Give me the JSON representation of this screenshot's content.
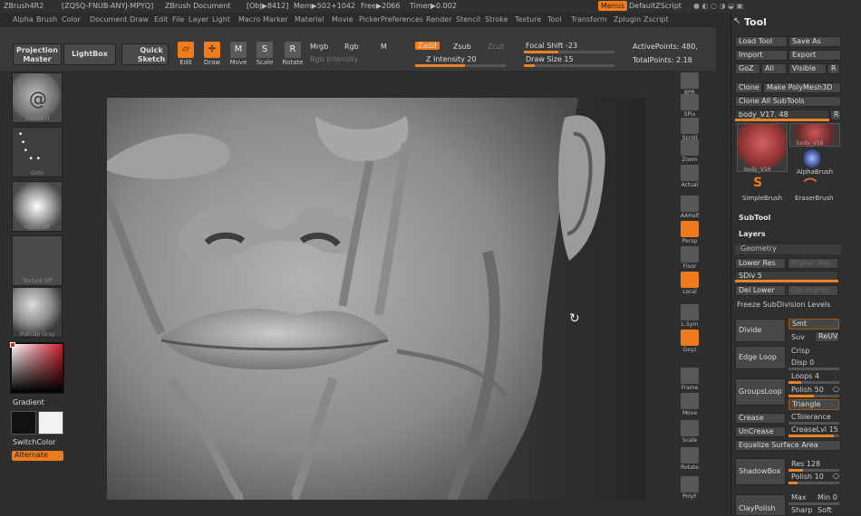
{
  "titlebar": {
    "app": "ZBrush4R2",
    "serial": "[ZQSQ-FNUB-ANYJ-MPYQ]",
    "doc": "ZBrush Document",
    "obj": "[Obj▶8412]",
    "mem": "Mem▶502+1042",
    "free": "Free▶2066",
    "timer": "Timer▶0.002",
    "menus": "Menus",
    "script": "DefaultZScript"
  },
  "menu": [
    "Alpha",
    "Brush",
    "Color",
    "Document",
    "Draw",
    "Edit",
    "File",
    "Layer",
    "Light",
    "Macro",
    "Marker",
    "Material",
    "Movie",
    "Picker",
    "Preferences",
    "Render",
    "Stencil",
    "Stroke",
    "Texture",
    "Tool",
    "Transform",
    "Zplugin",
    "Zscript"
  ],
  "top": {
    "projection": "Projection Master",
    "lightbox": "LightBox",
    "quicksketch": "Quick Sketch",
    "edit": "Edit",
    "draw": "Draw",
    "move": "Move",
    "scale": "Scale",
    "rotate": "Rotate",
    "mrgb": "Mrgb",
    "rgb": "Rgb",
    "m": "M",
    "rgbint": "Rgb Intensity",
    "zadd": "Zadd",
    "zsub": "Zsub",
    "zcut": "Zcut",
    "zint": "Z Intensity 20",
    "focal": "Focal Shift -23",
    "drawsize": "Draw Size 15",
    "active": "ActivePoints: 480,",
    "total": "TotalPoints: 2.18"
  },
  "left": {
    "brush": "Standard",
    "stroke": "Dots",
    "alpha": "Alpha Off",
    "texture": "Texture Off",
    "material": "MatCap Gray",
    "gradient": "Gradient",
    "switch": "SwitchColor",
    "alternate": "Alternate"
  },
  "right": [
    "BPR",
    "SPix",
    "Scroll",
    "Zoom",
    "Actual",
    "AAHalf",
    "Persp",
    "Floor",
    "Local",
    "L.Sym",
    "Gxyz",
    "Frame",
    "Move",
    "Scale",
    "Rotate",
    "PolyF"
  ],
  "tool": {
    "title": "Tool",
    "load": "Load Tool",
    "saveas": "Save As",
    "import": "Import",
    "export": "Export",
    "goz": "GoZ",
    "all": "All",
    "visible": "Visible",
    "r": "R",
    "clone": "Clone",
    "makepoly": "Make PolyMesh3D",
    "cloneall": "Clone All SubTools",
    "current": "body_V17. 48",
    "t1": "body_V18",
    "t2": "body_V18",
    "alphabrush": "AlphaBrush",
    "simplebrush": "SimpleBrush",
    "eraserbrush": "EraserBrush",
    "subtool": "SubTool",
    "layers": "Layers",
    "geometry": "Geometry",
    "lowerres": "Lower Res",
    "higherres": "Higher Res",
    "sdiv": "SDiv 5",
    "dellower": "Del Lower",
    "delhigher": "Del Higher",
    "freeze": "Freeze SubDivision Levels",
    "divide": "Divide",
    "smt": "Smt",
    "suv": "Suv",
    "reuv": "ReUV",
    "edgeloop": "Edge Loop",
    "crisp": "Crisp",
    "disp": "Disp 0",
    "groupsloop": "GroupsLoop",
    "loops": "Loops 4",
    "polish": "Polish 50",
    "triangle": "Triangle",
    "crease": "Crease",
    "ctol": "CTolerance",
    "uncrease": "UnCrease",
    "creaselvl": "CreaseLvl 15",
    "equalize": "Equalize Surface Area",
    "shadowbox": "ShadowBox",
    "res": "Res 128",
    "polish2": "Polish 10",
    "claypolish": "ClayPolish",
    "max": "Max",
    "min": "Min 0",
    "sharp": "Sharp",
    "soft": "Soft"
  }
}
